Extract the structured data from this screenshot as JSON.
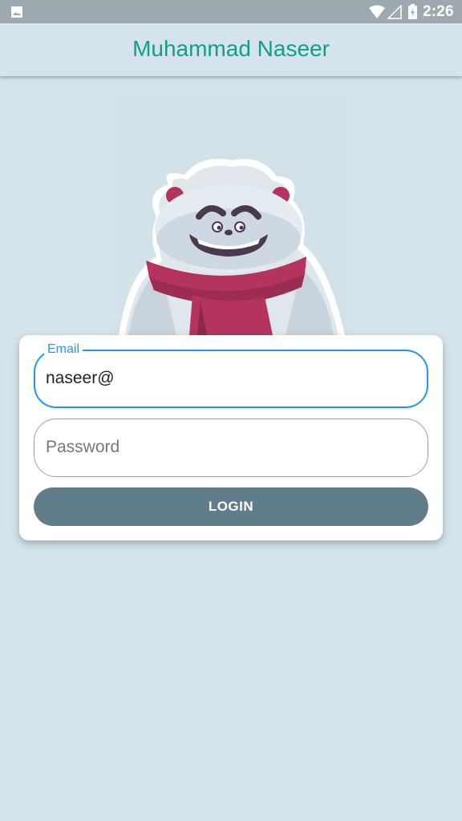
{
  "status_bar": {
    "time": "2:26",
    "icons": [
      "gallery-icon",
      "wifi-icon",
      "signal-icon",
      "battery-icon"
    ]
  },
  "app_bar": {
    "title": "Muhammad Naseer"
  },
  "mascot": {
    "icon": "bear-with-scarf-icon"
  },
  "login_form": {
    "email_label": "Email",
    "email_value": "naseer@",
    "password_placeholder": "Password",
    "login_label": "LOGIN"
  },
  "colors": {
    "background": "#d5e3ec",
    "title": "#129e88",
    "focus_border": "#2196f3",
    "button": "#617d89"
  }
}
